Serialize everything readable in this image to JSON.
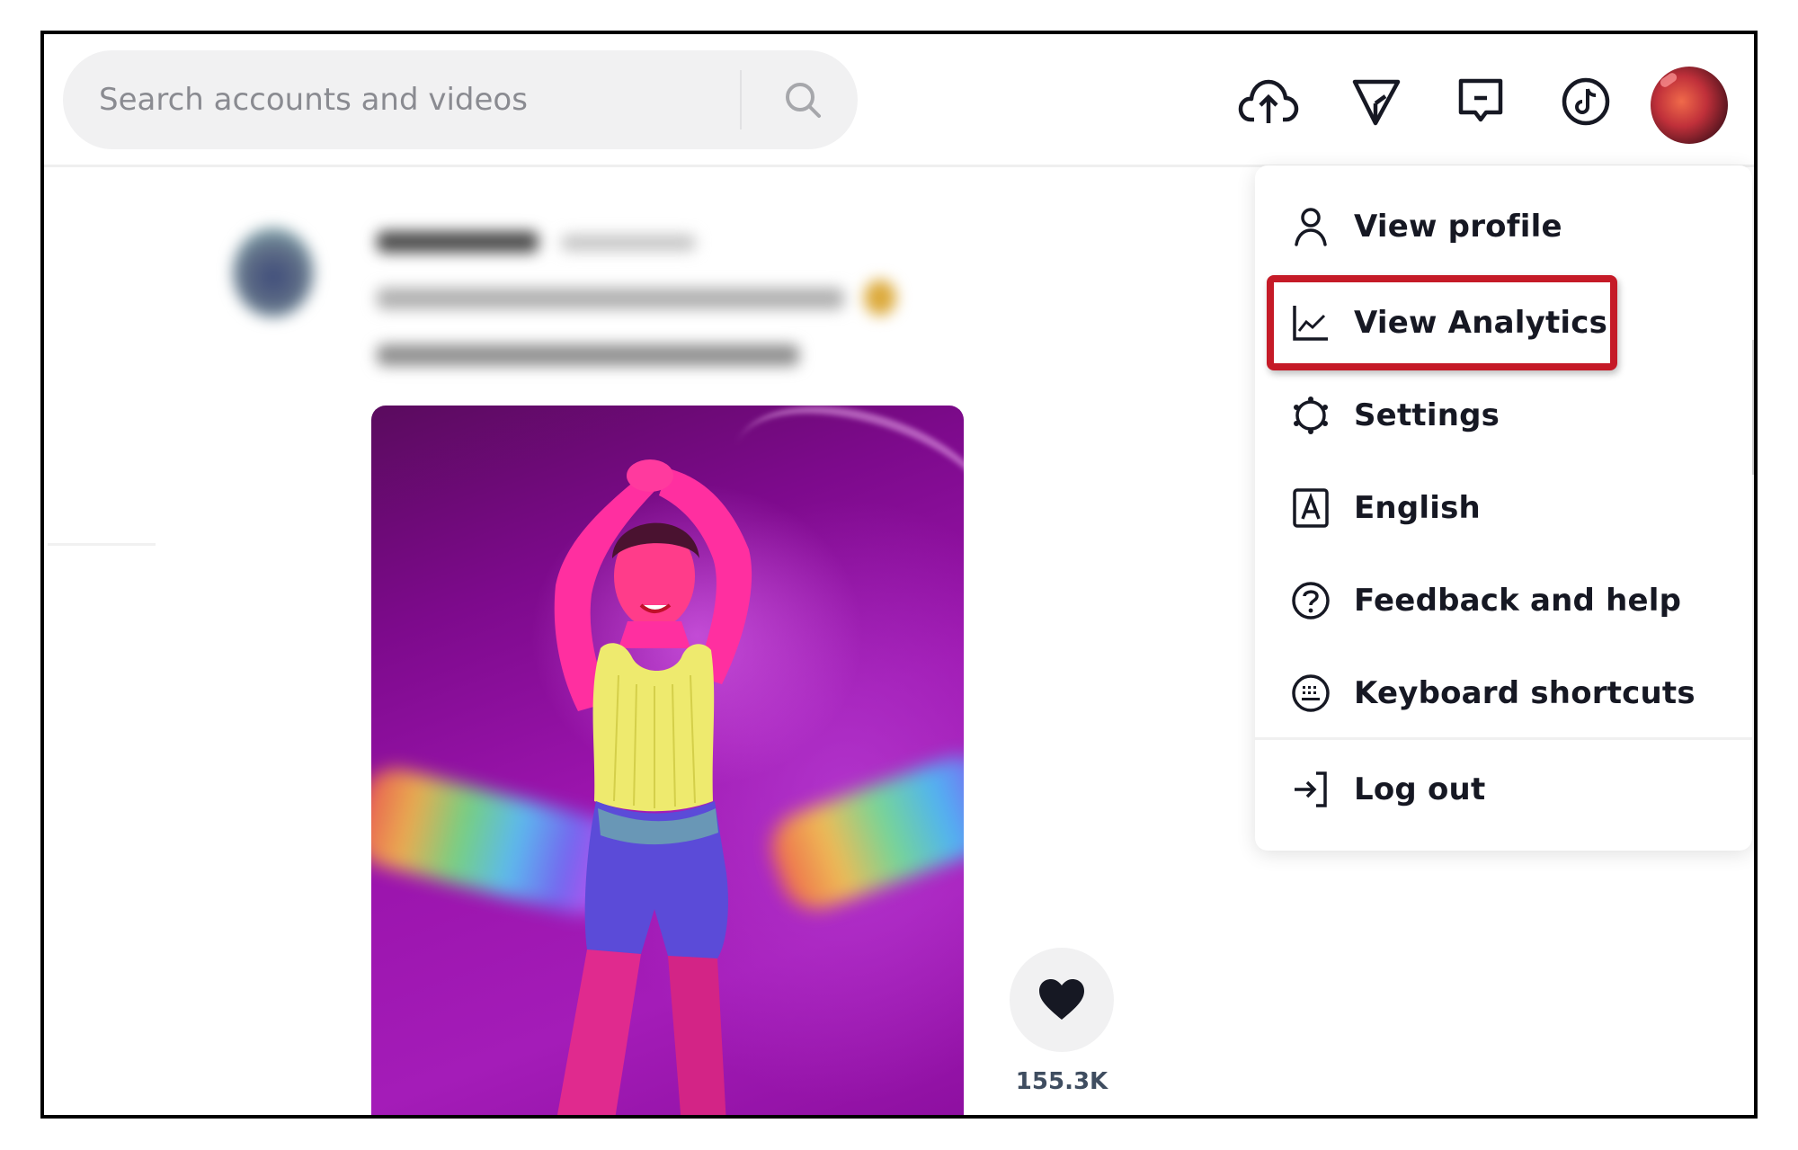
{
  "header": {
    "search": {
      "placeholder": "Search accounts and videos",
      "value": ""
    },
    "icons": [
      "upload-icon",
      "send-icon",
      "inbox-icon",
      "tiktok-logo-icon"
    ],
    "avatar": "user-avatar"
  },
  "post": {
    "author_blurred": true,
    "caption_blurred": true,
    "music_blurred": true,
    "likes": "155.3K"
  },
  "profile_menu": {
    "items": [
      {
        "label": "View profile",
        "icon": "person-icon"
      },
      {
        "label": "View Analytics",
        "icon": "analytics-chart-icon",
        "highlighted": true
      },
      {
        "label": "Settings",
        "icon": "gear-icon"
      },
      {
        "label": "English",
        "icon": "language-icon"
      },
      {
        "label": "Feedback and help",
        "icon": "help-circle-icon"
      },
      {
        "label": "Keyboard shortcuts",
        "icon": "keyboard-icon"
      }
    ],
    "logout": {
      "label": "Log out",
      "icon": "logout-icon"
    }
  },
  "colors": {
    "highlight_border": "#c51a27",
    "text_primary": "#161823",
    "search_bg": "#f1f1f2"
  }
}
